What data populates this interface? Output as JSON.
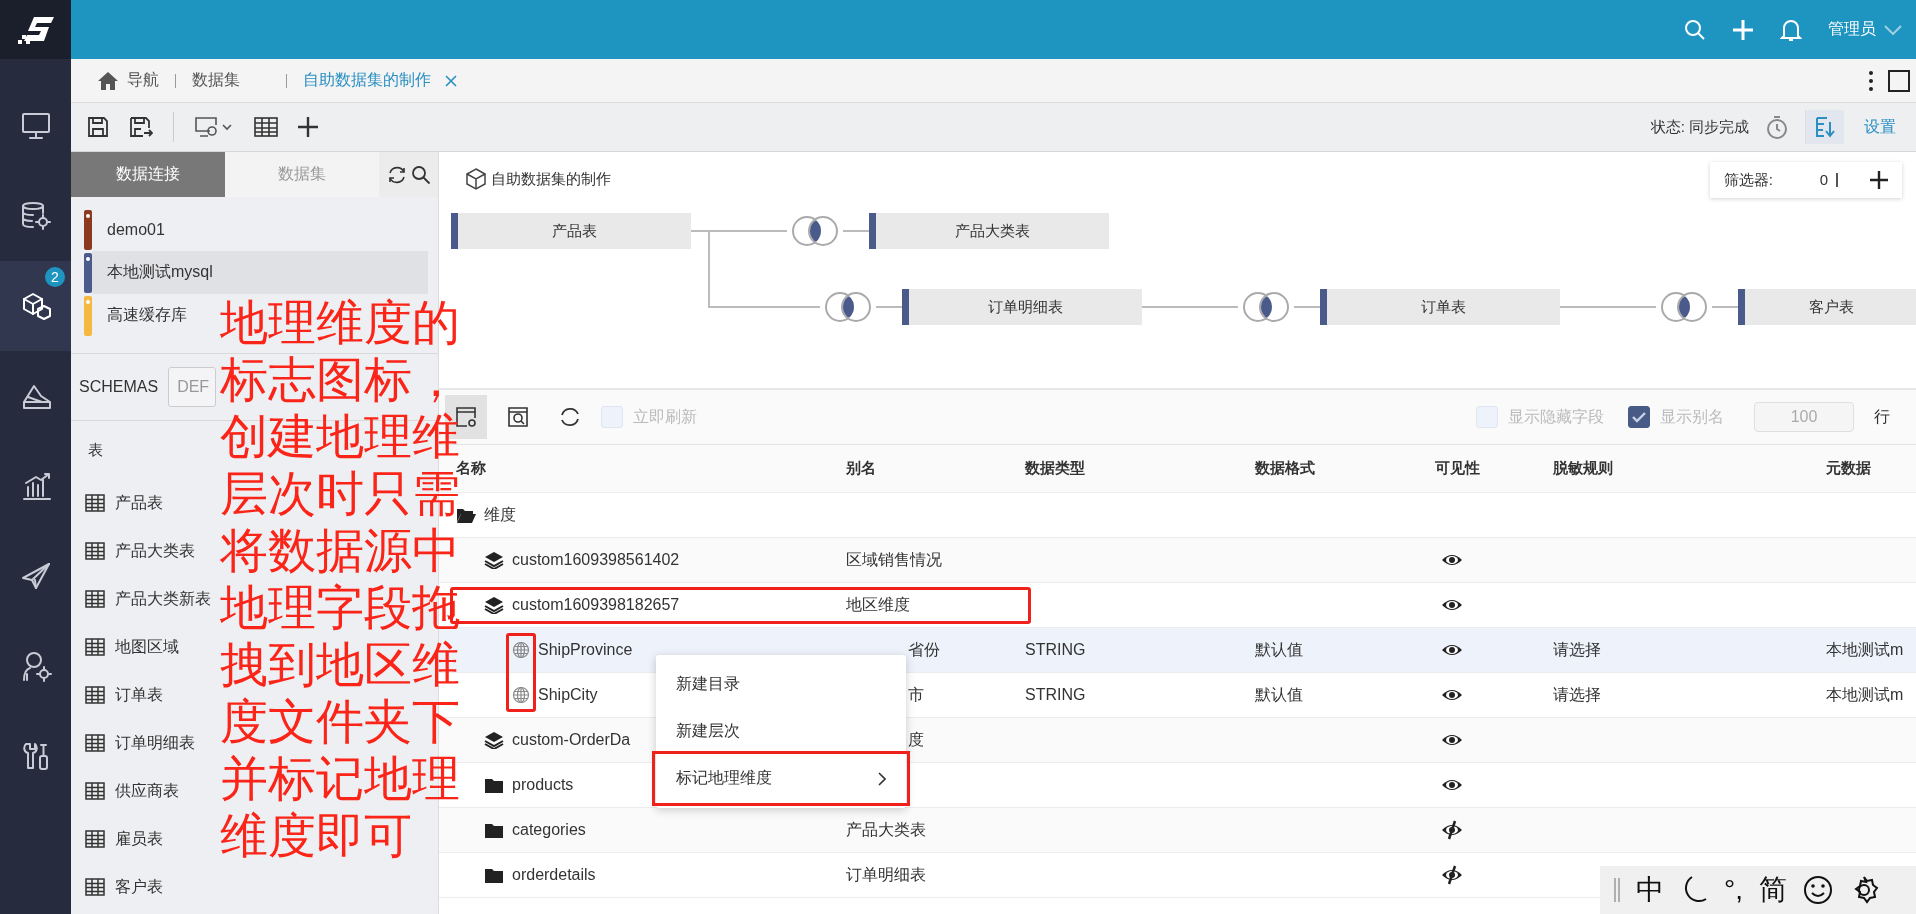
{
  "nav": [
    {
      "kind": "monitor",
      "selected": false
    },
    {
      "kind": "database",
      "selected": false
    },
    {
      "kind": "cube",
      "selected": true,
      "badge": "2"
    },
    {
      "kind": "ramp",
      "selected": false
    },
    {
      "kind": "chart",
      "selected": false
    },
    {
      "kind": "plane",
      "selected": false
    },
    {
      "kind": "user_gear",
      "selected": false
    },
    {
      "kind": "tools",
      "selected": false
    }
  ],
  "header": {
    "user": "管理员"
  },
  "tabs": {
    "home": "导航",
    "items": [
      {
        "label": "数据集",
        "selected": false,
        "closable": false
      },
      {
        "label": "自助数据集的制作",
        "selected": true,
        "closable": true
      }
    ]
  },
  "toolbar": {
    "status": "状态: 同步完成",
    "settings": "设置"
  },
  "left_panel": {
    "tabs": [
      {
        "label": "数据连接",
        "selected": true
      },
      {
        "label": "数据集",
        "selected": false
      }
    ],
    "connections": [
      {
        "name": "demo01",
        "color": "#8b3a1f",
        "selected": false
      },
      {
        "name": "本地测试mysql",
        "color": "#4a5a8a",
        "selected": true
      },
      {
        "name": "高速缓存库",
        "color": "#f5b942",
        "selected": false
      }
    ],
    "schemas_label": "SCHEMAS",
    "schema": "DEF",
    "tables_label": "表",
    "tables": [
      "产品表",
      "产品大类表",
      "产品大类新表",
      "地图区域",
      "订单表",
      "订单明细表",
      "供应商表",
      "雇员表",
      "客户表"
    ]
  },
  "annotation": {
    "text": "地理维度的标志图标，创建地理维层次时只需将数据源中地理字段拖拽到地区维度文件夹下并标记地理维度即可"
  },
  "canvas": {
    "title": "自助数据集的制作",
    "filter_label": "筛选器:",
    "filter_count": "0",
    "root": {
      "label": "产品表",
      "children": [
        {
          "label": "产品大类表"
        },
        {
          "label": "订单明细表",
          "children": [
            {
              "label": "订单表",
              "children": [
                {
                  "label": "客户表"
                }
              ]
            }
          ]
        }
      ]
    }
  },
  "field_panel": {
    "auto_refresh": {
      "label": "立即刷新",
      "checked": false
    },
    "show_hidden": {
      "label": "显示隐藏字段",
      "checked": false
    },
    "show_alias": {
      "label": "显示别名",
      "checked": true
    },
    "row_limit": "100",
    "row_unit": "行",
    "columns": [
      "名称",
      "别名",
      "数据类型",
      "数据格式",
      "可见性",
      "脱敏规则",
      "元数据"
    ],
    "rows": [
      {
        "kind": "open_folder",
        "name": "维度",
        "selected": false,
        "children": [
          {
            "kind": "hierarchy",
            "name": "custom1609398561402",
            "alias": "区域销售情况",
            "visible": true,
            "selected": false
          },
          {
            "kind": "hierarchy",
            "name": "custom1609398182657",
            "alias": "地区维度",
            "visible": true,
            "selected": false,
            "highlighted": true,
            "children": [
              {
                "kind": "geo_field",
                "name": "ShipProvince",
                "alias": "省份",
                "alias_cut": true,
                "type": "STRING",
                "format": "默认值",
                "visible": true,
                "mask": "请选择",
                "metadata": "本地测试m",
                "selected": true,
                "icon_highlighted": true
              },
              {
                "kind": "geo_field",
                "name": "ShipCity",
                "alias": "市",
                "alias_cut": true,
                "type": "STRING",
                "format": "默认值",
                "visible": true,
                "mask": "请选择",
                "metadata": "本地测试m",
                "selected": false,
                "icon_highlighted": true
              }
            ]
          },
          {
            "kind": "hierarchy",
            "name": "custom-OrderDa",
            "alias": "度",
            "alias_cut": true,
            "visible": true,
            "selected": false
          },
          {
            "kind": "folder",
            "name": "products",
            "visible": true,
            "selected": false
          },
          {
            "kind": "folder",
            "name": "categories",
            "alias": "产品大类表",
            "visible": false,
            "selected": false
          },
          {
            "kind": "folder",
            "name": "orderdetails",
            "alias": "订单明细表",
            "visible": false,
            "selected": false
          }
        ]
      }
    ]
  },
  "context_menu": {
    "items": [
      {
        "label": "新建目录",
        "submenu": false,
        "highlighted": false
      },
      {
        "label": "新建层次",
        "submenu": false,
        "highlighted": false
      },
      {
        "label": "标记地理维度",
        "submenu": true,
        "highlighted": true
      }
    ]
  },
  "ime_bar": {
    "items": [
      {
        "kind": "grip"
      },
      {
        "kind": "text",
        "text": "中"
      },
      {
        "kind": "moon"
      },
      {
        "kind": "text",
        "text": "°,"
      },
      {
        "kind": "text",
        "text": "简"
      },
      {
        "kind": "smiley"
      },
      {
        "kind": "gear"
      }
    ]
  }
}
